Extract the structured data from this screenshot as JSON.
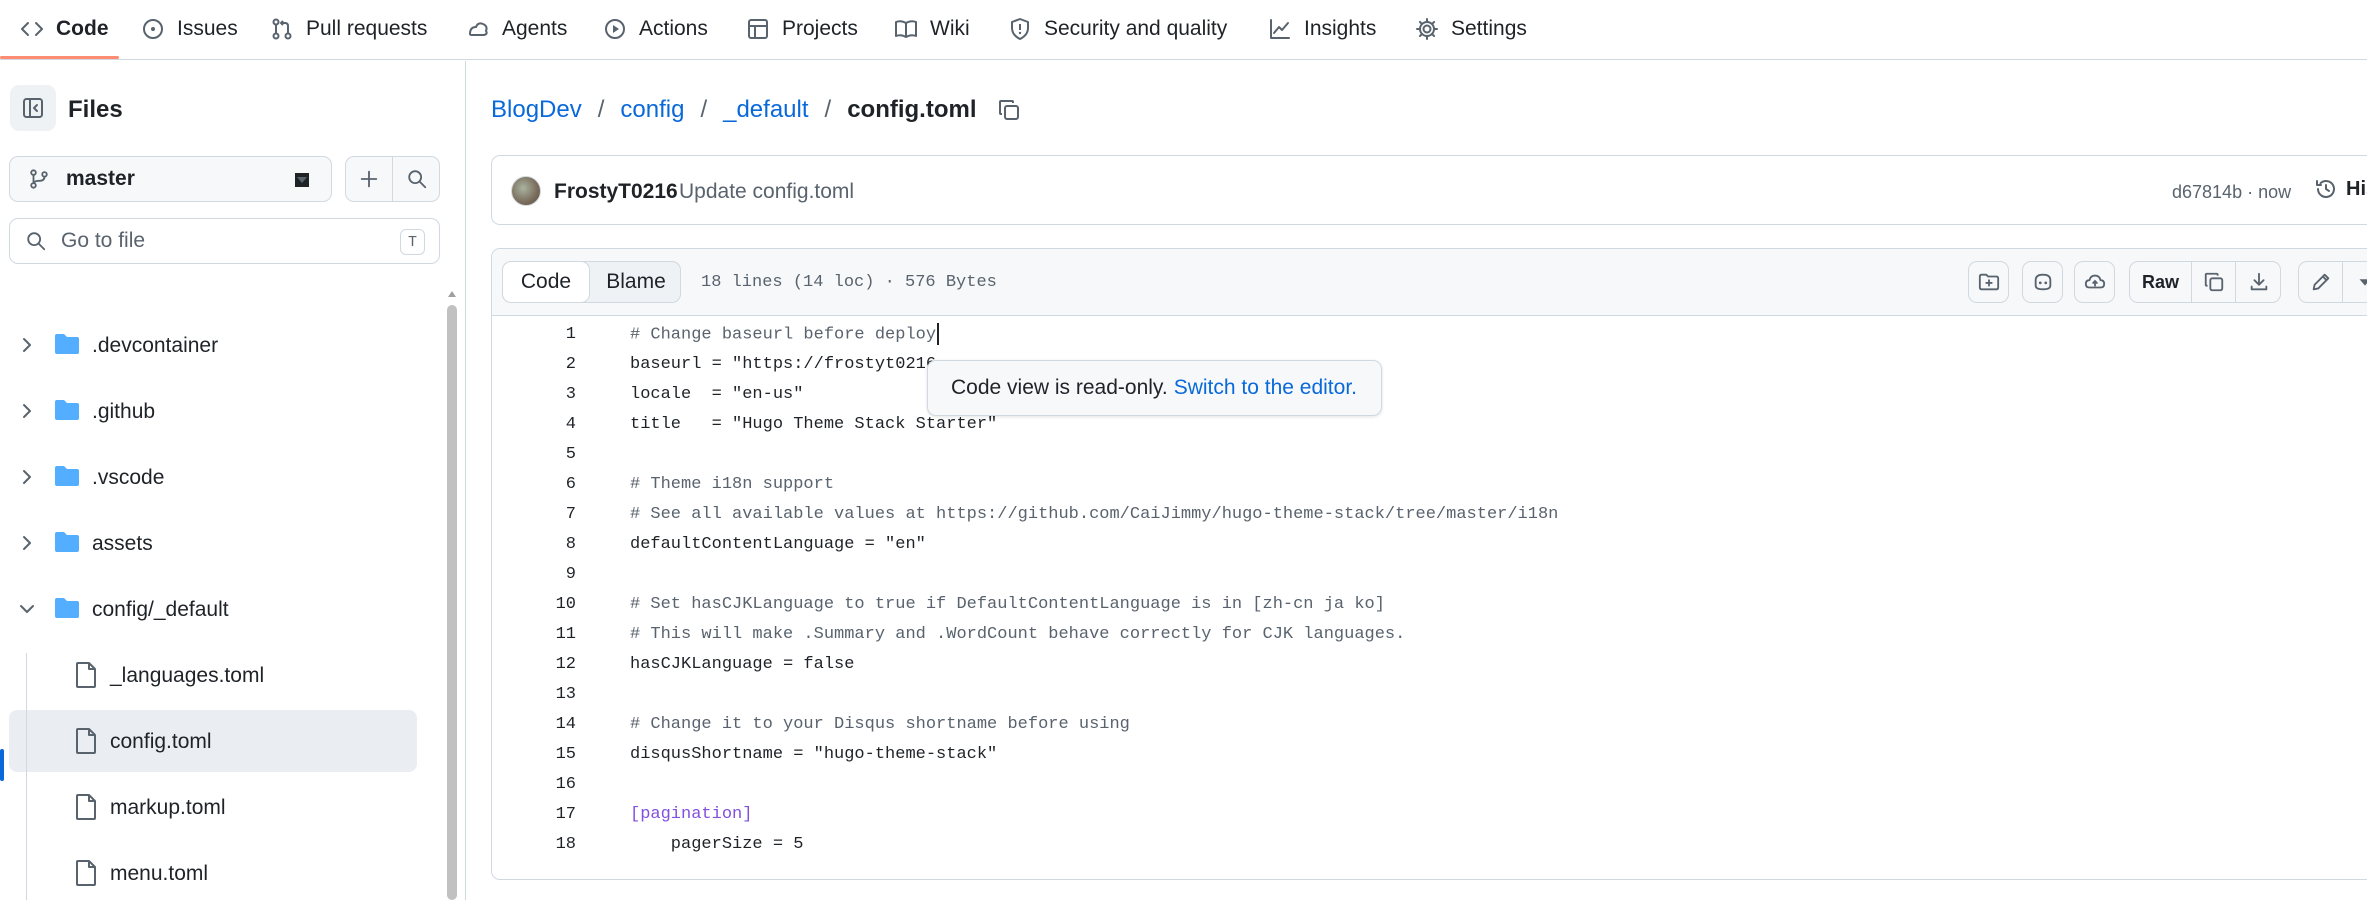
{
  "repo_nav": {
    "tabs": [
      {
        "label": "Code",
        "icon": "code-icon",
        "selected": true
      },
      {
        "label": "Issues",
        "icon": "issue-opened-icon"
      },
      {
        "label": "Pull requests",
        "icon": "git-pull-request-icon"
      },
      {
        "label": "Agents",
        "icon": "agent-icon"
      },
      {
        "label": "Actions",
        "icon": "play-icon"
      },
      {
        "label": "Projects",
        "icon": "table-icon"
      },
      {
        "label": "Wiki",
        "icon": "book-icon"
      },
      {
        "label": "Security and quality",
        "icon": "shield-icon"
      },
      {
        "label": "Insights",
        "icon": "graph-icon"
      },
      {
        "label": "Settings",
        "icon": "gear-icon"
      }
    ],
    "accent": "#fd8c73"
  },
  "tree": {
    "title": "Files",
    "branch": "master",
    "goto_placeholder": "Go to file",
    "goto_shortcut": "T",
    "items": [
      {
        "name": ".devcontainer",
        "type": "folder",
        "expanded": false
      },
      {
        "name": ".github",
        "type": "folder",
        "expanded": false
      },
      {
        "name": ".vscode",
        "type": "folder",
        "expanded": false
      },
      {
        "name": "assets",
        "type": "folder",
        "expanded": false
      },
      {
        "name": "config/_default",
        "type": "folder",
        "expanded": true
      },
      {
        "name": "_languages.toml",
        "type": "file"
      },
      {
        "name": "config.toml",
        "type": "file",
        "active": true
      },
      {
        "name": "markup.toml",
        "type": "file"
      },
      {
        "name": "menu.toml",
        "type": "file"
      }
    ]
  },
  "breadcrumb": {
    "repo": "BlogDev",
    "parts": [
      "config",
      "_default"
    ],
    "current": "config.toml",
    "separator": "/"
  },
  "commit": {
    "author": "FrostyT0216",
    "message": "Update config.toml",
    "meta": "d67814b · now",
    "history_label": "History"
  },
  "file": {
    "tabs": {
      "code": "Code",
      "blame": "Blame"
    },
    "info": "18 lines (14 loc) · 576 Bytes",
    "raw_label": "Raw"
  },
  "code_lines": [
    {
      "n": "1",
      "text": "# Change baseurl before deploy"
    },
    {
      "n": "2",
      "text": "baseurl = \"https://frostyt0216"
    },
    {
      "n": "3",
      "text": "locale  = \"en-us\""
    },
    {
      "n": "4",
      "text": "title   = \"Hugo Theme Stack Starter\""
    },
    {
      "n": "5",
      "text": ""
    },
    {
      "n": "6",
      "text": "# Theme i18n support"
    },
    {
      "n": "7",
      "text": "# See all available values at https://github.com/CaiJimmy/hugo-theme-stack/tree/master/i18n"
    },
    {
      "n": "8",
      "text": "defaultContentLanguage = \"en\""
    },
    {
      "n": "9",
      "text": ""
    },
    {
      "n": "10",
      "text": "# Set hasCJKLanguage to true if DefaultContentLanguage is in [zh-cn ja ko]"
    },
    {
      "n": "11",
      "text": "# This will make .Summary and .WordCount behave correctly for CJK languages."
    },
    {
      "n": "12",
      "text": "hasCJKLanguage = false"
    },
    {
      "n": "13",
      "text": ""
    },
    {
      "n": "14",
      "text": "# Change it to your Disqus shortname before using"
    },
    {
      "n": "15",
      "text": "disqusShortname = \"hugo-theme-stack\""
    },
    {
      "n": "16",
      "text": ""
    },
    {
      "n": "17",
      "text": "[pagination]"
    },
    {
      "n": "18",
      "text": "    pagerSize = 5"
    }
  ],
  "tooltip": {
    "text": "Code view is read-only.",
    "link": "Switch to the editor."
  }
}
